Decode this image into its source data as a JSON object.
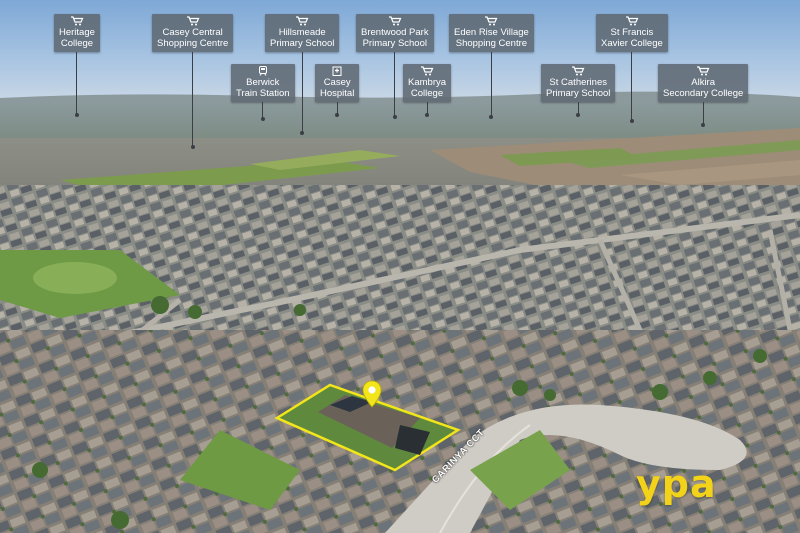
{
  "map": {
    "street_label": "CARINYA CCT",
    "brand_logo": "ypa",
    "highlight_color": "#f2e51a",
    "label_box_color": "#5f6973",
    "poi": [
      {
        "id": "heritage-college",
        "lines": [
          "Heritage",
          "College"
        ],
        "icon": "cart-icon"
      },
      {
        "id": "casey-central",
        "lines": [
          "Casey Central",
          "Shopping Centre"
        ],
        "icon": "cart-icon"
      },
      {
        "id": "hillsmeade",
        "lines": [
          "Hillsmeade",
          "Primary School"
        ],
        "icon": "cart-icon"
      },
      {
        "id": "brentwood-park",
        "lines": [
          "Brentwood Park",
          "Primary School"
        ],
        "icon": "cart-icon"
      },
      {
        "id": "eden-rise",
        "lines": [
          "Eden Rise Village",
          "Shopping Centre"
        ],
        "icon": "cart-icon"
      },
      {
        "id": "st-francis",
        "lines": [
          "St Francis",
          "Xavier College"
        ],
        "icon": "cart-icon"
      },
      {
        "id": "berwick-station",
        "lines": [
          "Berwick",
          "Train Station"
        ],
        "icon": "train-icon"
      },
      {
        "id": "casey-hospital",
        "lines": [
          "Casey",
          "Hospital"
        ],
        "icon": "hospital-icon"
      },
      {
        "id": "kambrya",
        "lines": [
          "Kambrya",
          "College"
        ],
        "icon": "cart-icon"
      },
      {
        "id": "st-catherines",
        "lines": [
          "St Catherines",
          "Primary School"
        ],
        "icon": "cart-icon"
      },
      {
        "id": "alkira",
        "lines": [
          "Alkira",
          "Secondary College"
        ],
        "icon": "cart-icon"
      }
    ]
  }
}
